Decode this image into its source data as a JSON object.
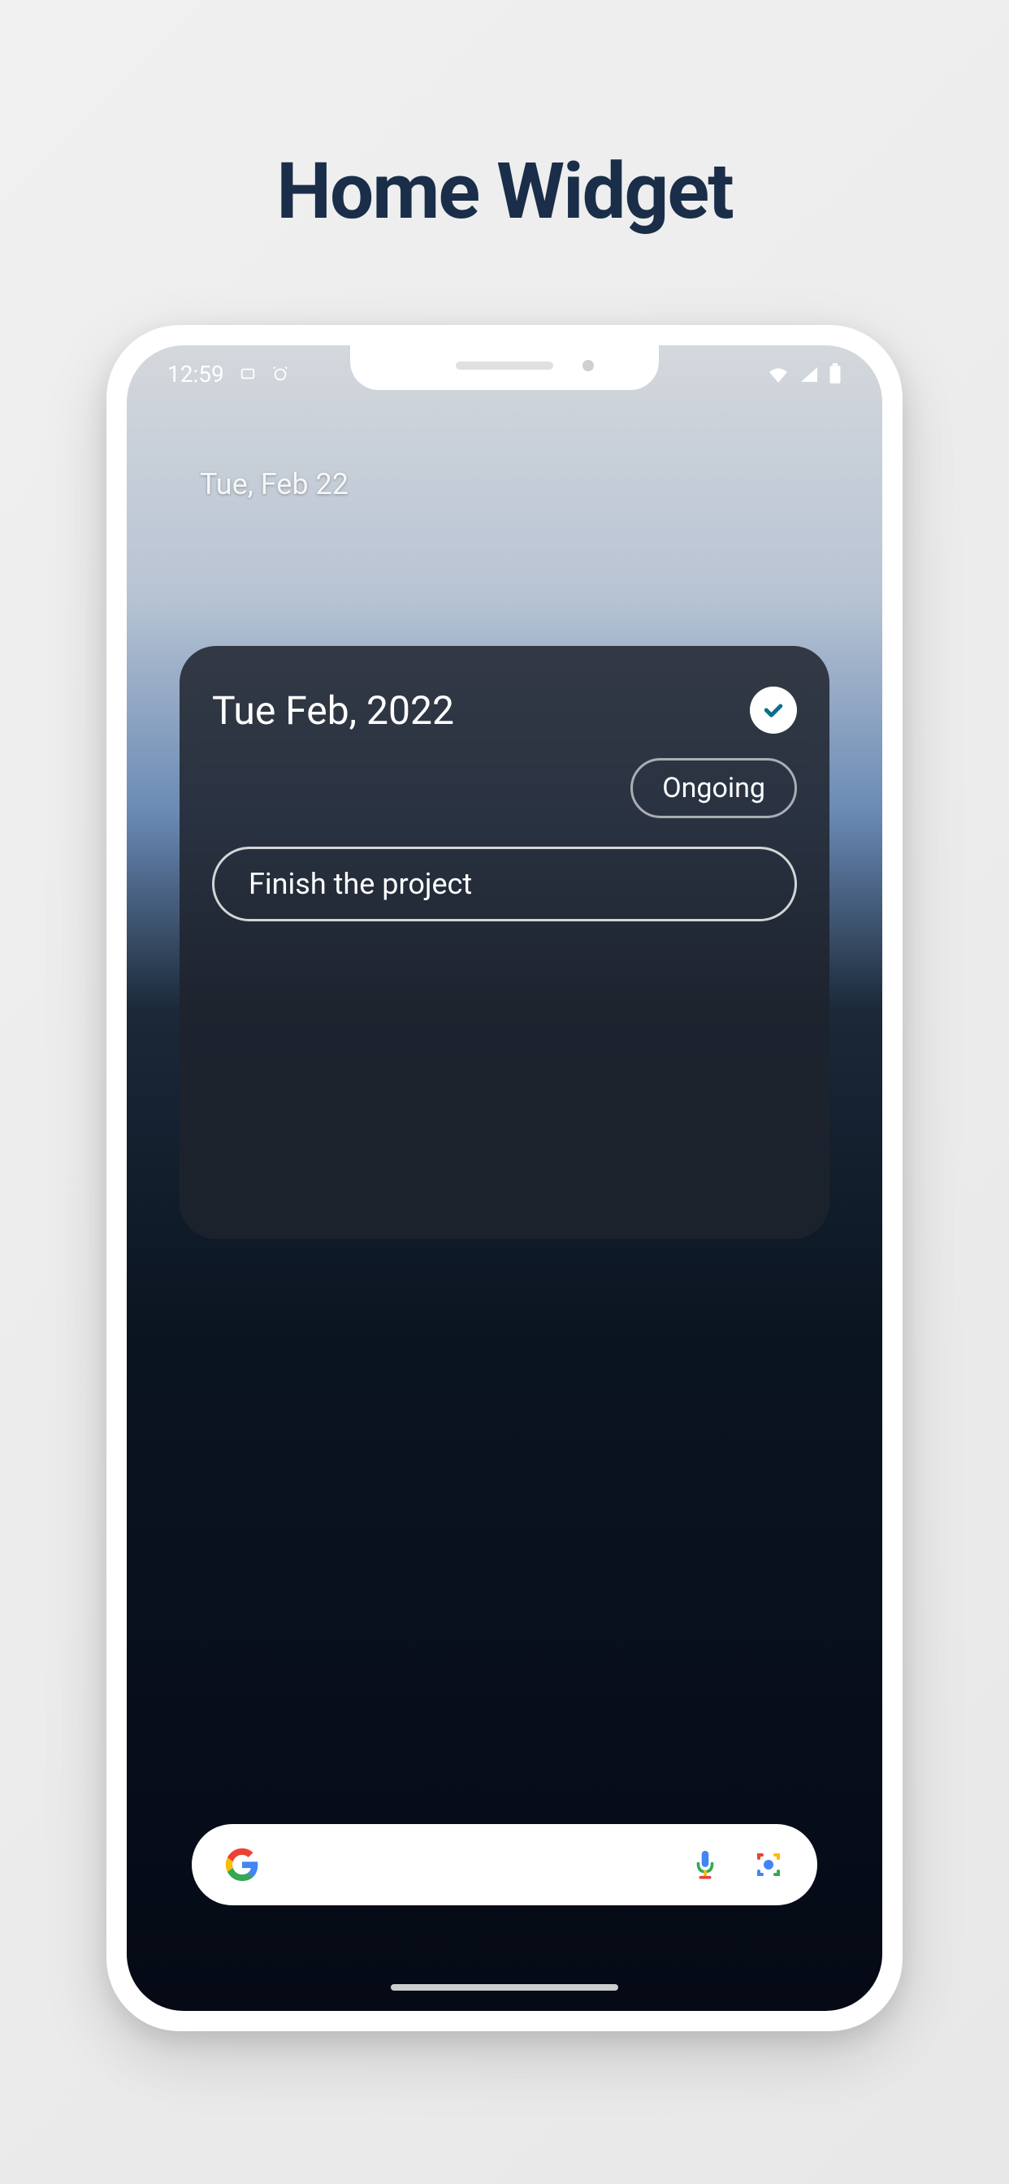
{
  "page": {
    "title": "Home Widget"
  },
  "statusBar": {
    "time": "12:59",
    "icons": {
      "card": "card-icon",
      "alarm": "alarm-icon",
      "wifi": "wifi-icon",
      "signal": "signal-icon",
      "battery": "battery-icon"
    }
  },
  "homeScreen": {
    "date": "Tue, Feb 22"
  },
  "widget": {
    "date": "Tue Feb, 2022",
    "filter": "Ongoing",
    "tasks": [
      {
        "title": "Finish the project"
      }
    ]
  },
  "searchBar": {
    "placeholder": ""
  }
}
